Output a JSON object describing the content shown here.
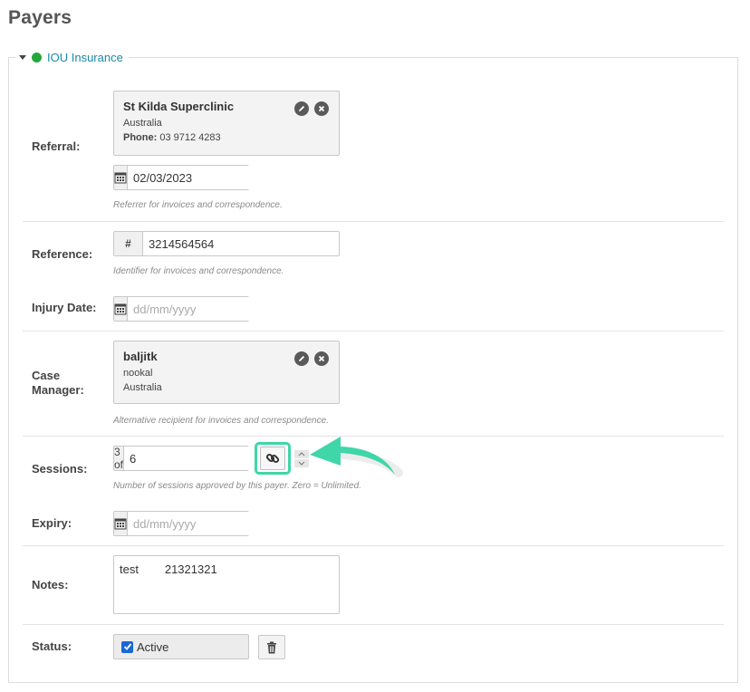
{
  "page": {
    "title": "Payers"
  },
  "payer": {
    "name": "IOU Insurance",
    "status_color": "#22a83a"
  },
  "referral": {
    "label": "Referral:",
    "name": "St Kilda Superclinic",
    "country": "Australia",
    "phone_label": "Phone:",
    "phone": "03 9712 4283",
    "date": "02/03/2023",
    "help": "Referrer for invoices and correspondence."
  },
  "reference": {
    "label": "Reference:",
    "value": "3214564564",
    "addon": "#",
    "help": "Identifier for invoices and correspondence."
  },
  "injury_date": {
    "label": "Injury Date:",
    "placeholder": "dd/mm/yyyy"
  },
  "case_manager": {
    "label_line1": "Case",
    "label_line2": "Manager:",
    "name": "baljitk",
    "line2": "nookal",
    "country": "Australia",
    "help": "Alternative recipient for invoices and correspondence."
  },
  "sessions": {
    "label": "Sessions:",
    "prefix": "3 of",
    "value": "6",
    "help": "Number of sessions approved by this payer. Zero = Unlimited."
  },
  "expiry": {
    "label": "Expiry:",
    "placeholder": "dd/mm/yyyy"
  },
  "notes": {
    "label": "Notes:",
    "value": "test        21321321"
  },
  "status": {
    "label": "Status:",
    "value": "Active",
    "checked": true
  },
  "colors": {
    "accent": "#3fd6a8",
    "link": "#1a8aa8",
    "checkbox": "#1868d6"
  },
  "icons": [
    "caret-down-icon",
    "edit-icon",
    "remove-icon",
    "calendar-icon",
    "hash-icon",
    "link-icon",
    "trash-icon",
    "checkbox-icon",
    "arrow-callout-icon"
  ]
}
